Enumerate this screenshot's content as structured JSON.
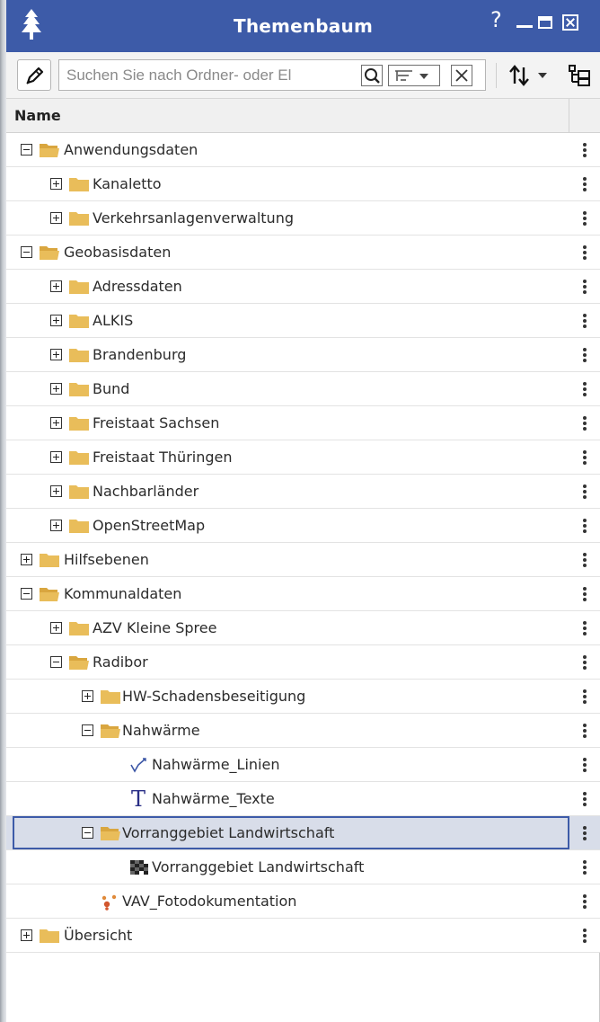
{
  "window": {
    "title": "Themenbaum",
    "help": "?"
  },
  "toolbar": {
    "search_placeholder": "Suchen Sie nach Ordner- oder El",
    "search_value": ""
  },
  "header": {
    "name_column": "Name"
  },
  "colors": {
    "accent": "#3d5ba8",
    "folder": "#e9bd5a",
    "selection_bg": "#d8dde9"
  },
  "tree": [
    {
      "label": "Anwendungsdaten",
      "level": 0,
      "type": "folder-open",
      "expander": "minus"
    },
    {
      "label": "Kanaletto",
      "level": 1,
      "type": "folder",
      "expander": "plus"
    },
    {
      "label": "Verkehrsanlagenverwaltung",
      "level": 1,
      "type": "folder",
      "expander": "plus"
    },
    {
      "label": "Geobasisdaten",
      "level": 0,
      "type": "folder-open",
      "expander": "minus"
    },
    {
      "label": "Adressdaten",
      "level": 1,
      "type": "folder",
      "expander": "plus"
    },
    {
      "label": "ALKIS",
      "level": 1,
      "type": "folder",
      "expander": "plus"
    },
    {
      "label": "Brandenburg",
      "level": 1,
      "type": "folder",
      "expander": "plus"
    },
    {
      "label": "Bund",
      "level": 1,
      "type": "folder",
      "expander": "plus"
    },
    {
      "label": "Freistaat Sachsen",
      "level": 1,
      "type": "folder",
      "expander": "plus"
    },
    {
      "label": "Freistaat Thüringen",
      "level": 1,
      "type": "folder",
      "expander": "plus"
    },
    {
      "label": "Nachbarländer",
      "level": 1,
      "type": "folder",
      "expander": "plus"
    },
    {
      "label": "OpenStreetMap",
      "level": 1,
      "type": "folder",
      "expander": "plus"
    },
    {
      "label": "Hilfsebenen",
      "level": 0,
      "type": "folder",
      "expander": "plus"
    },
    {
      "label": "Kommunaldaten",
      "level": 0,
      "type": "folder-open",
      "expander": "minus"
    },
    {
      "label": "AZV Kleine Spree",
      "level": 1,
      "type": "folder",
      "expander": "plus"
    },
    {
      "label": "Radibor",
      "level": 1,
      "type": "folder-open",
      "expander": "minus"
    },
    {
      "label": "HW-Schadensbeseitigung",
      "level": 2,
      "type": "folder",
      "expander": "plus"
    },
    {
      "label": "Nahwärme",
      "level": 2,
      "type": "folder-open",
      "expander": "minus"
    },
    {
      "label": "Nahwärme_Linien",
      "level": 3,
      "type": "line-layer",
      "expander": "none"
    },
    {
      "label": "Nahwärme_Texte",
      "level": 3,
      "type": "text-layer",
      "expander": "none"
    },
    {
      "label": "Vorranggebiet Landwirtschaft",
      "level": 2,
      "type": "folder-open",
      "expander": "minus",
      "selected": true
    },
    {
      "label": "Vorranggebiet Landwirtschaft",
      "level": 3,
      "type": "polygon-layer",
      "expander": "none"
    },
    {
      "label": "VAV_Fotodokumentation",
      "level": 2,
      "type": "point-layer",
      "expander": "none"
    },
    {
      "label": "Übersicht",
      "level": 0,
      "type": "folder",
      "expander": "plus"
    }
  ]
}
